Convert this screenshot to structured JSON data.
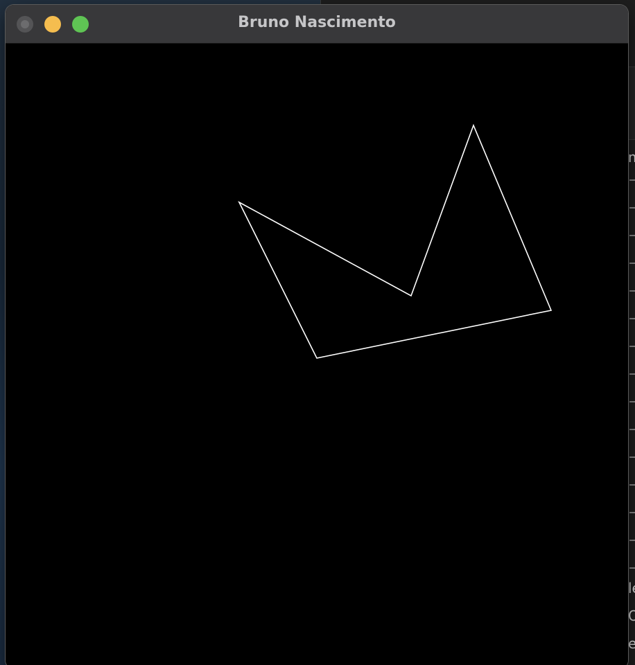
{
  "window": {
    "title": "Bruno Nascimento"
  },
  "traffic_lights": {
    "close_color": "#545456",
    "minimize_color": "#f5bd4f",
    "maximize_color": "#5fc454"
  },
  "canvas": {
    "background": "#000000",
    "stroke_color": "#ffffff"
  },
  "background_window": {
    "edge_chars": [
      "m",
      "le",
      "O",
      "e"
    ]
  }
}
